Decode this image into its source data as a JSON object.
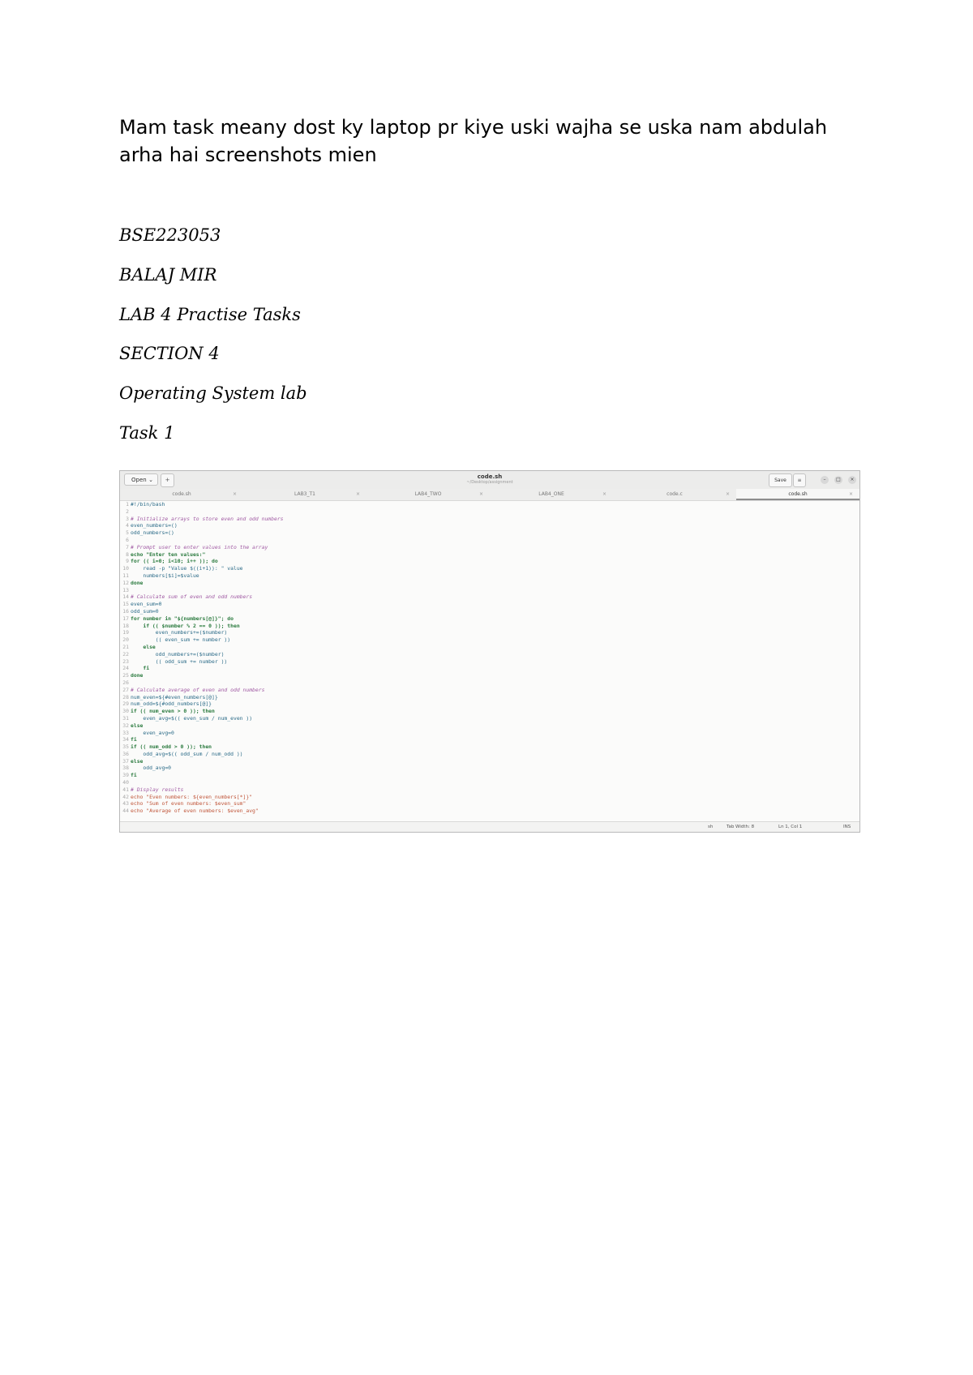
{
  "document": {
    "intro": "Mam task meany dost ky laptop pr kiye uski wajha se uska nam abdulah arha hai screenshots mien",
    "student_id": "BSE223053",
    "student_name": "BALAJ MIR",
    "lab_title": "LAB 4 Practise Tasks",
    "section": "SECTION 4",
    "course": "Operating System lab",
    "task_label": "Task 1"
  },
  "editor": {
    "open_label": "Open",
    "window_title": "code.sh",
    "window_subtitle": "~/Desktop/assignment",
    "save_label": "Save",
    "tabs": [
      {
        "label": "code.sh"
      },
      {
        "label": "LAB3_T1"
      },
      {
        "label": "LAB4_TWO"
      },
      {
        "label": "LAB4_ONE"
      },
      {
        "label": "code.c"
      },
      {
        "label": "code.sh"
      }
    ],
    "lines": [
      {
        "n": "1",
        "text": "#!/bin/bash",
        "kind": "t-code"
      },
      {
        "n": "2",
        "text": "",
        "kind": "t-plain"
      },
      {
        "n": "3",
        "text": "# Initialize arrays to store even and odd numbers",
        "kind": "t-comment"
      },
      {
        "n": "4",
        "text": "even_numbers=()",
        "kind": "t-code"
      },
      {
        "n": "5",
        "text": "odd_numbers=()",
        "kind": "t-code"
      },
      {
        "n": "6",
        "text": "",
        "kind": "t-plain"
      },
      {
        "n": "7",
        "text": "# Prompt user to enter values into the array",
        "kind": "t-comment"
      },
      {
        "n": "8",
        "text": "echo \"Enter ten values:\"",
        "kind": "t-kw"
      },
      {
        "n": "9",
        "text": "for (( i=0; i<10; i++ )); do",
        "kind": "t-kw"
      },
      {
        "n": "10",
        "text": "    read -p \"Value $((i+1)): \" value",
        "kind": "t-code"
      },
      {
        "n": "11",
        "text": "    numbers[$i]=$value",
        "kind": "t-code"
      },
      {
        "n": "12",
        "text": "done",
        "kind": "t-kw"
      },
      {
        "n": "13",
        "text": "",
        "kind": "t-plain"
      },
      {
        "n": "14",
        "text": "# Calculate sum of even and odd numbers",
        "kind": "t-comment"
      },
      {
        "n": "15",
        "text": "even_sum=0",
        "kind": "t-code"
      },
      {
        "n": "16",
        "text": "odd_sum=0",
        "kind": "t-code"
      },
      {
        "n": "17",
        "text": "for number in \"${numbers[@]}\"; do",
        "kind": "t-kw"
      },
      {
        "n": "18",
        "text": "    if (( $number % 2 == 0 )); then",
        "kind": "t-kw"
      },
      {
        "n": "19",
        "text": "        even_numbers+=($number)",
        "kind": "t-code"
      },
      {
        "n": "20",
        "text": "        (( even_sum += number ))",
        "kind": "t-code"
      },
      {
        "n": "21",
        "text": "    else",
        "kind": "t-kw"
      },
      {
        "n": "22",
        "text": "        odd_numbers+=($number)",
        "kind": "t-code"
      },
      {
        "n": "23",
        "text": "        (( odd_sum += number ))",
        "kind": "t-code"
      },
      {
        "n": "24",
        "text": "    fi",
        "kind": "t-kw"
      },
      {
        "n": "25",
        "text": "done",
        "kind": "t-kw"
      },
      {
        "n": "26",
        "text": "",
        "kind": "t-plain"
      },
      {
        "n": "27",
        "text": "# Calculate average of even and odd numbers",
        "kind": "t-comment"
      },
      {
        "n": "28",
        "text": "num_even=${#even_numbers[@]}",
        "kind": "t-code"
      },
      {
        "n": "29",
        "text": "num_odd=${#odd_numbers[@]}",
        "kind": "t-code"
      },
      {
        "n": "30",
        "text": "if (( num_even > 0 )); then",
        "kind": "t-kw"
      },
      {
        "n": "31",
        "text": "    even_avg=$(( even_sum / num_even ))",
        "kind": "t-code"
      },
      {
        "n": "32",
        "text": "else",
        "kind": "t-kw"
      },
      {
        "n": "33",
        "text": "    even_avg=0",
        "kind": "t-code"
      },
      {
        "n": "34",
        "text": "fi",
        "kind": "t-kw"
      },
      {
        "n": "35",
        "text": "if (( num_odd > 0 )); then",
        "kind": "t-kw"
      },
      {
        "n": "36",
        "text": "    odd_avg=$(( odd_sum / num_odd ))",
        "kind": "t-code"
      },
      {
        "n": "37",
        "text": "else",
        "kind": "t-kw"
      },
      {
        "n": "38",
        "text": "    odd_avg=0",
        "kind": "t-code"
      },
      {
        "n": "39",
        "text": "fi",
        "kind": "t-kw"
      },
      {
        "n": "40",
        "text": "",
        "kind": "t-plain"
      },
      {
        "n": "41",
        "text": "# Display results",
        "kind": "t-comment"
      },
      {
        "n": "42",
        "text": "echo \"Even numbers: ${even_numbers[*]}\"",
        "kind": "t-str"
      },
      {
        "n": "43",
        "text": "echo \"Sum of even numbers: $even_sum\"",
        "kind": "t-str"
      },
      {
        "n": "44",
        "text": "echo \"Average of even numbers: $even_avg\"",
        "kind": "t-str"
      }
    ],
    "status": {
      "language": "sh",
      "tab_width": "Tab Width: 8",
      "cursor": "Ln 1, Col 1",
      "mode": "INS"
    }
  }
}
